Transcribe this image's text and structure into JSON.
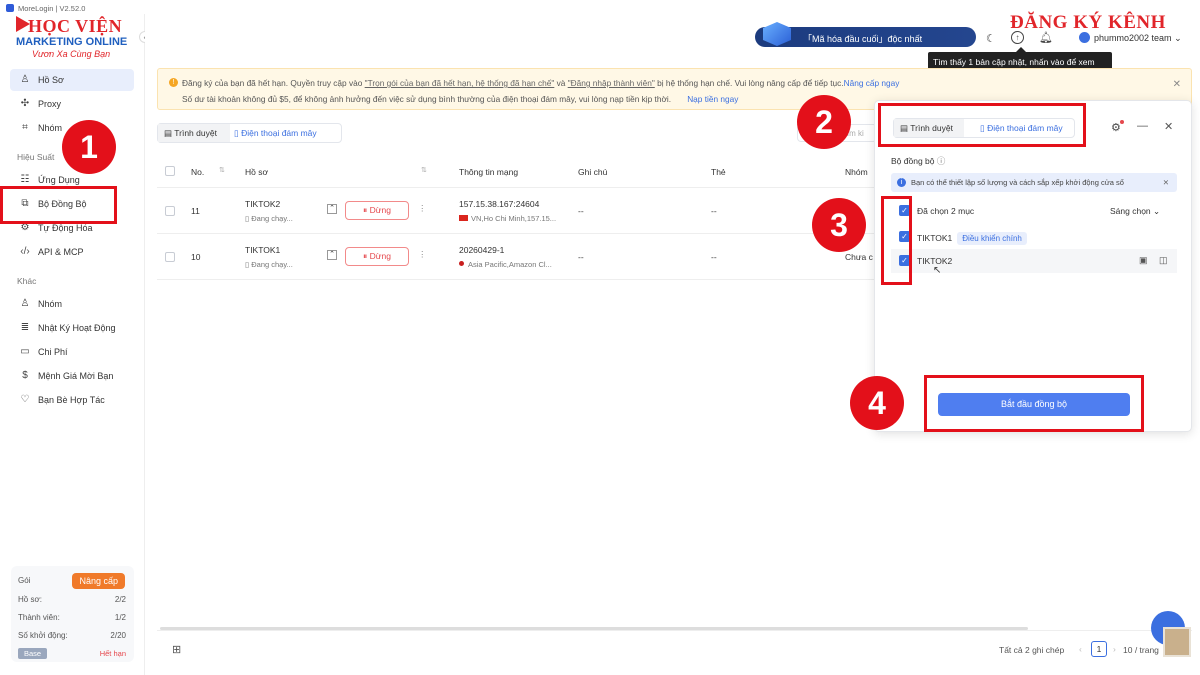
{
  "window": {
    "title": "MoreLogin | V2.52.0"
  },
  "logo": {
    "line1": "HỌC VIỆN",
    "line2": "MARKETING ONLINE",
    "line3": "Vươn Xa Cùng Bạn"
  },
  "overlay_title": "ĐĂNG KÝ KÊNH",
  "sidebar": {
    "items": [
      {
        "label": "Hồ Sơ",
        "icon": "user-icon"
      },
      {
        "label": "Proxy",
        "icon": "proxy-icon"
      },
      {
        "label": "Nhóm",
        "icon": "group-icon"
      }
    ],
    "section_performance": "Hiệu Suất",
    "perf_items": [
      {
        "label": "Ứng Dụng",
        "icon": "apps-icon"
      },
      {
        "label": "Bộ Đồng Bộ",
        "icon": "sync-icon"
      },
      {
        "label": "Tự Động Hóa",
        "icon": "automation-icon"
      },
      {
        "label": "API & MCP",
        "icon": "code-icon"
      }
    ],
    "section_other": "Khác",
    "other_items": [
      {
        "label": "Nhóm",
        "icon": "team-icon"
      },
      {
        "label": "Nhật Ký Hoạt Động",
        "icon": "log-icon"
      },
      {
        "label": "Chi Phí",
        "icon": "cost-icon"
      },
      {
        "label": "Mệnh Giá Mời Bạn",
        "icon": "dollar-icon"
      },
      {
        "label": "Bạn Bè Hợp Tác",
        "icon": "partner-icon"
      }
    ],
    "plan": {
      "label": "Gói",
      "upgrade": "Nâng cấp",
      "profiles_label": "Hồ sơ:",
      "profiles_value": "2/2",
      "members_label": "Thành viên:",
      "members_value": "1/2",
      "launches_label": "Số khởi động:",
      "launches_value": "2/20",
      "base": "Base",
      "expired": "Hết hạn"
    }
  },
  "topbar": {
    "e2e": "「Mã hóa đầu cuối」độc nhất",
    "user": "phummo2002 team",
    "tooltip": "Tìm thấy 1 bản cập nhật, nhấn vào để xem"
  },
  "banner": {
    "p1": "Đăng ký của bạn đã hết hạn. Quyền truy cập vào ",
    "link1": "\"Trọn gói của bạn đã hết hạn, hệ thống đã hạn chế\"",
    "p2": " và ",
    "link2": "\"Đăng nhập thành viên\"",
    "p3": " bị hệ thống hạn chế. Vui lòng nâng cấp để tiếp tục.",
    "upgrade": "Nâng cấp ngay",
    "line2": "Số dư tài khoản không đủ $5, để không ảnh hưởng đến việc sử dụng bình thường của điện thoại đám mây, vui lòng nạp tiền kịp thời.",
    "topup": "Nạp tiền ngay"
  },
  "tabs": {
    "browser": "Trình duyệt",
    "cloud_phone": "Điện thoại đám mây"
  },
  "table": {
    "headers": {
      "no": "No.",
      "profile": "Hồ sơ",
      "network": "Thông tin mạng",
      "note": "Ghi chú",
      "tag": "Thẻ",
      "group": "Nhóm"
    },
    "rows": [
      {
        "no": "11",
        "name": "TIKTOK2",
        "status": "Đang chạy...",
        "stop": "Dừng",
        "ip": "157.15.38.167:24604",
        "loc": "VN,Ho Chi Minh,157.15...",
        "note": "--",
        "tag": "--",
        "group": ""
      },
      {
        "no": "10",
        "name": "TIKTOK1",
        "status": "Đang chạy...",
        "stop": "Dừng",
        "ip": "20260429-1",
        "loc": "Asia Pacific,Amazon Cl...",
        "note": "--",
        "tag": "--",
        "group": "Chưa c"
      }
    ],
    "search_placeholder": "Tìm ki"
  },
  "footer": {
    "total": "Tất cả 2 ghi chép",
    "page": "1",
    "per_page": "10 / trang"
  },
  "sync_panel": {
    "tab_browser": "Trình duyệt",
    "tab_cloud": "Điện thoại đám mây",
    "title": "Bộ đồng bộ",
    "info": "Bạn có thể thiết lập số lượng và cách sắp xếp khởi động cửa sổ",
    "selected": "Đã chọn 2 mục",
    "arrange": "Sáng chọn",
    "items": [
      {
        "name": "TIKTOK1",
        "tag": "Điều khiển chính"
      },
      {
        "name": "TIKTOK2",
        "tag": ""
      }
    ],
    "start": "Bắt đầu đồng bộ"
  },
  "annotations": {
    "n1": "1",
    "n2": "2",
    "n3": "3",
    "n4": "4"
  },
  "colors": {
    "accent": "#3b6fe0",
    "danger": "#e3101a",
    "warning_bg": "#fff8e6"
  }
}
